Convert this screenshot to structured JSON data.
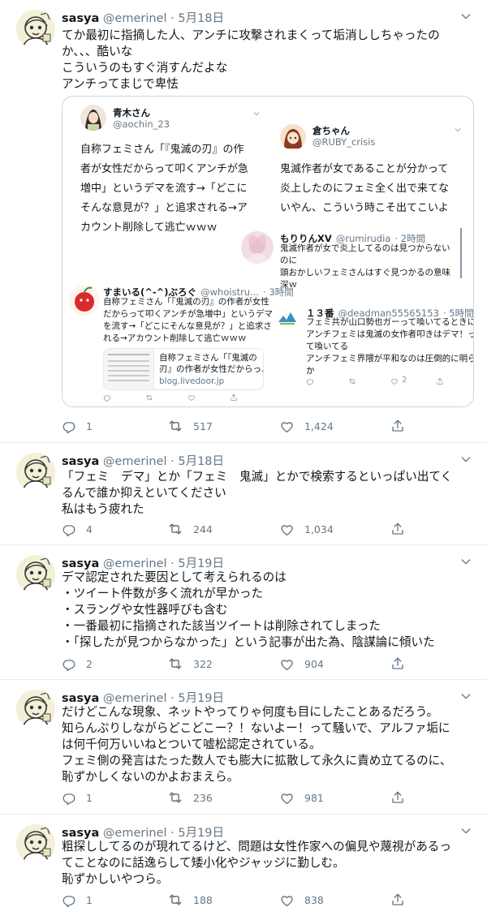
{
  "tweets": [
    {
      "name": "sasya",
      "handle": "@emerinel",
      "date": "5月18日",
      "lines": [
        "てか最初に指摘した人、アンチに攻撃されまくって垢消ししちゃったの",
        "か、、、酷いな",
        "こういうのもすぐ消すんだよな",
        "アンチってまじで卑怯"
      ],
      "reply": "1",
      "retweet": "517",
      "like": "1,424"
    },
    {
      "name": "sasya",
      "handle": "@emerinel",
      "date": "5月18日",
      "lines": [
        "「フェミ　デマ」とか「フェミ　鬼滅」とかで検索するといっぱい出てく",
        "るんで誰か抑えといてください",
        "私はもう疲れた"
      ],
      "reply": "4",
      "retweet": "244",
      "like": "1,034"
    },
    {
      "name": "sasya",
      "handle": "@emerinel",
      "date": "5月19日",
      "lines": [
        "デマ認定された要因として考えられるのは",
        "・ツイート件数が多く流れが早かった",
        "・スラングや女性器呼びも含む",
        "・一番最初に指摘された該当ツイートは削除されてしまった",
        "・「探したが見つからなかった」という記事が出た為、陰謀論に傾いた"
      ],
      "reply": "2",
      "retweet": "322",
      "like": "904"
    },
    {
      "name": "sasya",
      "handle": "@emerinel",
      "date": "5月19日",
      "lines": [
        "だけどこんな現象、ネットやってりゃ何度も目にしたことあるだろう。",
        "知らんぷりしながらどこどこー？！ないよー！って騒いで、アルファ垢に",
        "は何千何万いいねとついて嘘松認定されている。",
        "フェミ側の発言はたった数人でも膨大に拡散して永久に責め立てるのに、",
        "恥ずかしくないのかよおまえら。"
      ],
      "reply": "1",
      "retweet": "236",
      "like": "981"
    },
    {
      "name": "sasya",
      "handle": "@emerinel",
      "date": "5月19日",
      "lines": [
        "粗探ししてるのが現れてるけど、問題は女性作家への偏見や蔑視があるっ",
        "てことなのに話逸らして矮小化やジャッジに勤しむ。",
        "恥ずかしいやつら。"
      ],
      "reply": "1",
      "retweet": "188",
      "like": "838"
    }
  ],
  "quoted": {
    "aochin": {
      "name": "青木さん",
      "handle": "@aochin_23",
      "lines": [
        "自称フェミさん「『鬼滅の刃』の作",
        "者が女性だからって叩くアンチが急",
        "増中」というデマを流す→「どこに",
        "そんな意見が？」と追求される→ア",
        "カウント削除して逃亡ｗｗｗ"
      ]
    },
    "kura": {
      "name": "倉ちゃん",
      "handle": "@RUBY_crisis",
      "lines": [
        "鬼滅作者が女であることが分かって",
        "炎上したのにフェミ全く出で来てな",
        "いやん、こういう時こそ出てこいよ"
      ]
    },
    "moririn": {
      "name": "もりりんXV",
      "handle": "@rumirudia",
      "time": "· 2時間",
      "lines": [
        "鬼滅作者が女で炎上してるのは見つからない",
        "のに",
        "頭おかしいフェミさんはすぐ見つかるの意味",
        "深ｗ"
      ]
    },
    "sumairu": {
      "name": "すまいる(^-^)ぶろぐ",
      "handle": "@whoistru...",
      "time": "· 3時間",
      "lines": [
        "自称フェミさん「『鬼滅の刃』の作者が女性",
        "だからって叩くアンチが急増中」というデマ",
        "を流す→「どこにそんな意見が？」と追求さ",
        "れる→アカウント削除して逃亡ｗｗｗ"
      ],
      "card_title": [
        "自称フェミさん「『鬼滅の",
        "刃』の作者が女性だからっ..."
      ],
      "card_domain": "blog.livedoor.jp"
    },
    "jusan": {
      "name": "１３番",
      "handle": "@deadman55565153",
      "time": "· 5時間",
      "lines": [
        "フェミ共が山口勢也ガーって喚いてるときに",
        "アンチフェミは鬼滅の女作者叩きはデマ！っ",
        "て喚いてる",
        "アンチフェミ界隈が平和なのは圧倒的に明ら",
        "か"
      ],
      "like": "2"
    }
  }
}
